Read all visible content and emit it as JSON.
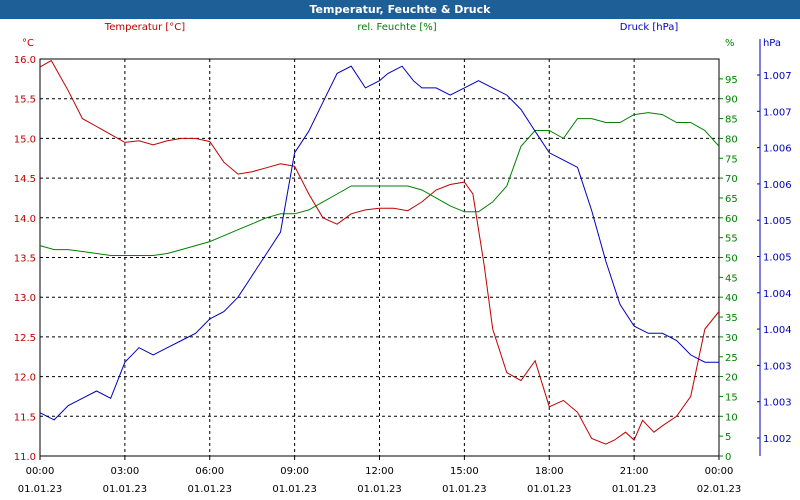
{
  "window": {
    "title": "Temperatur, Feuchte & Druck"
  },
  "chart_data": {
    "type": "line",
    "title": "Temperatur, Feuchte & Druck",
    "grid": true,
    "x_ticks": [
      {
        "time": "00:00",
        "date": "01.01.23"
      },
      {
        "time": "03:00",
        "date": "01.01.23"
      },
      {
        "time": "06:00",
        "date": "01.01.23"
      },
      {
        "time": "09:00",
        "date": "01.01.23"
      },
      {
        "time": "12:00",
        "date": "01.01.23"
      },
      {
        "time": "15:00",
        "date": "01.01.23"
      },
      {
        "time": "18:00",
        "date": "01.01.23"
      },
      {
        "time": "21:00",
        "date": "01.01.23"
      },
      {
        "time": "00:00",
        "date": "02.01.23"
      }
    ],
    "x_range_hours": [
      0,
      24
    ],
    "axes": {
      "temperature": {
        "label": "Temperatur [°C]",
        "unit": "°C",
        "color": "#c00000",
        "ylim": [
          11.0,
          16.0
        ],
        "ticks": [
          "11.0",
          "11.5",
          "12.0",
          "12.5",
          "13.0",
          "13.5",
          "14.0",
          "14.5",
          "15.0",
          "15.5",
          "16.0"
        ]
      },
      "humidity": {
        "label": "rel. Feuchte [%]",
        "unit": "%",
        "color": "#008000",
        "ylim": [
          0,
          100
        ],
        "ticks": [
          "0",
          "5",
          "10",
          "15",
          "20",
          "25",
          "30",
          "35",
          "40",
          "45",
          "50",
          "55",
          "60",
          "65",
          "70",
          "75",
          "80",
          "85",
          "90",
          "95"
        ]
      },
      "pressure": {
        "label": "Druck [hPa]",
        "unit": "hPa",
        "color": "#0000c0",
        "ylim": [
          1.002,
          1.0075
        ],
        "ticks": [
          "1.002",
          "1.003",
          "1.003",
          "1.004",
          "1.004",
          "1.005",
          "1.005",
          "1.006",
          "1.006",
          "1.007",
          "1.007"
        ]
      }
    },
    "series": [
      {
        "name": "Temperatur [°C]",
        "axis": "temperature",
        "color": "#c00000",
        "x": [
          0,
          0.4,
          1,
          1.5,
          2,
          2.5,
          3,
          3.5,
          4,
          4.5,
          5,
          5.5,
          6,
          6.5,
          7,
          7.5,
          8,
          8.5,
          9,
          9.5,
          10,
          10.5,
          11,
          11.5,
          12,
          12.5,
          13,
          13.5,
          14,
          14.5,
          15,
          15.3,
          15.7,
          16,
          16.5,
          17,
          17.5,
          18,
          18.5,
          19,
          19.5,
          20,
          20.3,
          20.7,
          21,
          21.3,
          21.7,
          22,
          22.5,
          23,
          23.5,
          24
        ],
        "values": [
          15.9,
          15.98,
          15.6,
          15.25,
          15.15,
          15.05,
          14.95,
          14.97,
          14.92,
          14.97,
          15.0,
          15.0,
          14.96,
          14.7,
          14.55,
          14.58,
          14.63,
          14.68,
          14.65,
          14.3,
          14.0,
          13.92,
          14.05,
          14.1,
          14.12,
          14.12,
          14.09,
          14.2,
          14.35,
          14.42,
          14.45,
          14.3,
          13.4,
          12.6,
          12.05,
          11.95,
          12.2,
          11.62,
          11.7,
          11.55,
          11.22,
          11.15,
          11.2,
          11.3,
          11.2,
          11.45,
          11.3,
          11.38,
          11.5,
          11.75,
          12.6,
          12.82
        ]
      },
      {
        "name": "rel. Feuchte [%]",
        "axis": "humidity",
        "color": "#008000",
        "x": [
          0,
          0.5,
          1,
          1.5,
          2,
          2.5,
          3,
          3.5,
          4,
          4.5,
          5,
          5.5,
          6,
          6.5,
          7,
          7.5,
          8,
          8.5,
          9,
          9.5,
          10,
          10.5,
          11,
          11.5,
          12,
          12.5,
          13,
          13.5,
          14,
          14.5,
          15,
          15.5,
          16,
          16.5,
          17,
          17.5,
          18,
          18.5,
          19,
          19.5,
          20,
          20.5,
          21,
          21.5,
          22,
          22.5,
          23,
          23.5,
          24
        ],
        "values": [
          53,
          52,
          52,
          51.5,
          51,
          50.5,
          50.5,
          50.5,
          50.5,
          51,
          52,
          53,
          54,
          55.5,
          57,
          58.5,
          60,
          61,
          61,
          62,
          64,
          66,
          68,
          68,
          68,
          68,
          68,
          67,
          65,
          63,
          61.5,
          61.5,
          64,
          68,
          78,
          82,
          82,
          80,
          85,
          85,
          84,
          84,
          86,
          86.5,
          86,
          84,
          84,
          82,
          78
        ]
      },
      {
        "name": "Druck [hPa]",
        "axis": "pressure",
        "color": "#0000c0",
        "x": [
          0,
          0.5,
          1,
          1.5,
          2,
          2.5,
          3,
          3.5,
          4,
          4.5,
          5,
          5.5,
          6,
          6.5,
          7,
          7.5,
          8,
          8.5,
          9,
          9.5,
          10,
          10.5,
          11,
          11.5,
          12,
          12.3,
          12.8,
          13.2,
          13.5,
          14,
          14.5,
          15,
          15.5,
          16,
          16.5,
          17,
          17.5,
          18,
          18.5,
          19,
          19.5,
          20,
          20.5,
          21,
          21.5,
          22,
          22.5,
          23,
          23.5,
          24
        ],
        "values": [
          1.0026,
          1.0025,
          1.0027,
          1.0028,
          1.0029,
          1.0028,
          1.0033,
          1.0035,
          1.0034,
          1.0035,
          1.0036,
          1.0037,
          1.0039,
          1.004,
          1.0042,
          1.0045,
          1.0048,
          1.0051,
          1.0062,
          1.0065,
          1.0069,
          1.0073,
          1.0074,
          1.0071,
          1.0072,
          1.0073,
          1.0074,
          1.0072,
          1.0071,
          1.0071,
          1.007,
          1.0071,
          1.0072,
          1.0071,
          1.007,
          1.0068,
          1.0065,
          1.0062,
          1.0061,
          1.006,
          1.0054,
          1.0047,
          1.0041,
          1.0038,
          1.0037,
          1.0037,
          1.0036,
          1.0034,
          1.0033,
          1.0033
        ]
      }
    ]
  }
}
